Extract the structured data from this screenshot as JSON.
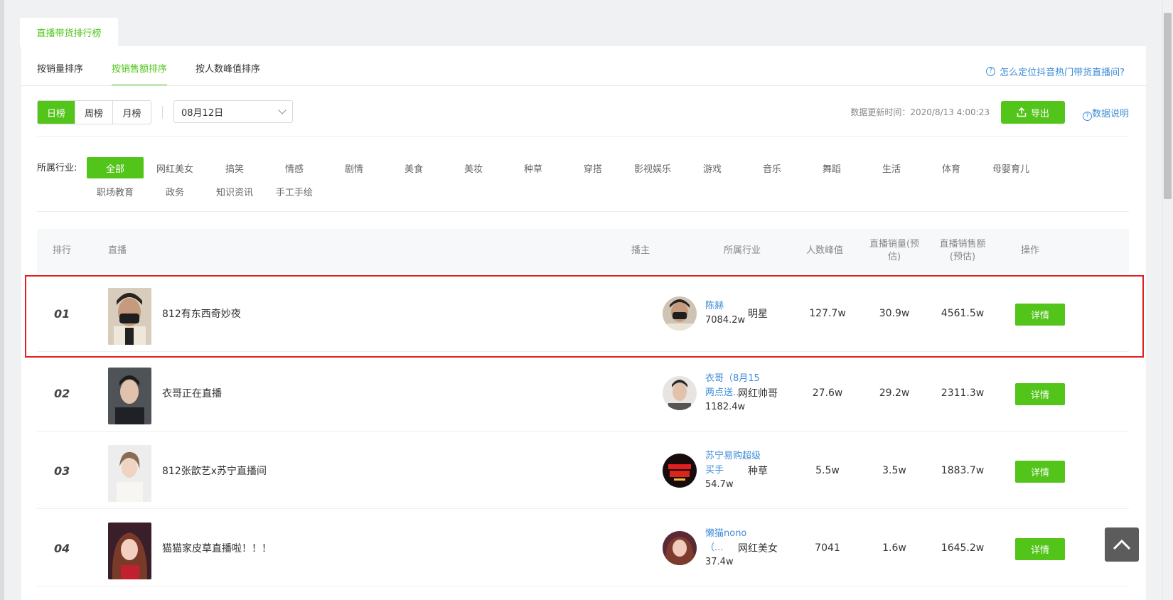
{
  "top_tab": "直播带货排行榜",
  "sort_tabs": [
    "按销量排序",
    "按销售额排序",
    "按人数峰值排序"
  ],
  "help_link": "怎么定位抖音热门带货直播间?",
  "periods": [
    "日榜",
    "周榜",
    "月榜"
  ],
  "date_value": "08月12日",
  "update_time": "数据更新时间：2020/8/13 4:00:23",
  "export_label": "导出",
  "data_desc": "数据说明",
  "industry_label": "所属行业:",
  "industries": [
    "全部",
    "网红美女",
    "搞笑",
    "情感",
    "剧情",
    "美食",
    "美妆",
    "种草",
    "穿搭",
    "影视娱乐",
    "游戏",
    "音乐",
    "舞蹈",
    "生活",
    "体育",
    "母婴育儿",
    "职场教育",
    "政务",
    "知识资讯",
    "手工手绘"
  ],
  "table_headers": {
    "rank": "排行",
    "live": "直播",
    "host": "播主",
    "industry": "所属行业",
    "peak": "人数峰值",
    "sales_volume": "直播销量(预估)",
    "sales_amount": "直播销售额(预估)",
    "action": "操作"
  },
  "rows": [
    {
      "rank": "01",
      "title": "812有东西奇妙夜",
      "host_name": "陈赫",
      "host_fans": "7084.2w",
      "industry": "明星",
      "peak": "127.7w",
      "volume": "30.9w",
      "amount": "4561.5w",
      "action": "详情"
    },
    {
      "rank": "02",
      "title": "衣哥正在直播",
      "host_name": "衣哥（8月15两点送...",
      "host_fans": "1182.4w",
      "industry": "网红帅哥",
      "peak": "27.6w",
      "volume": "29.2w",
      "amount": "2311.3w",
      "action": "详情"
    },
    {
      "rank": "03",
      "title": "812张歆艺x苏宁直播间",
      "host_name": "苏宁易购超级买手",
      "host_fans": "54.7w",
      "industry": "种草",
      "peak": "5.5w",
      "volume": "3.5w",
      "amount": "1883.7w",
      "action": "详情"
    },
    {
      "rank": "04",
      "title": "猫猫家皮草直播啦！！！",
      "host_name": "懒猫nono（...",
      "host_fans": "37.4w",
      "industry": "网红美女",
      "peak": "7041",
      "volume": "1.6w",
      "amount": "1645.2w",
      "action": "详情"
    }
  ],
  "colors": {
    "accent": "#52c41a",
    "link": "#3d8cd8",
    "highlight": "#e02020"
  }
}
